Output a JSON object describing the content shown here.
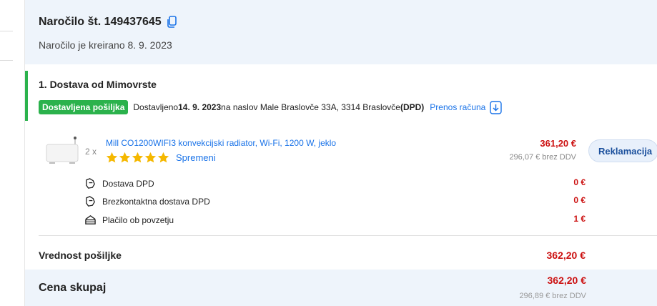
{
  "order": {
    "title": "Naročilo št. 149437645",
    "created": "Naročilo je kreirano 8. 9. 2023"
  },
  "shipment": {
    "title": "1. Dostava od Mimovrste",
    "badge": "Dostavljena pošiljka",
    "delivered_prefix": "Dostavljeno ",
    "delivered_date": "14. 9. 2023",
    "delivered_mid": " na naslov Male Braslovče 33A, 3314 Braslovče ",
    "carrier": "(DPD)",
    "invoice_link": "Prenos računa"
  },
  "product": {
    "qty": "2 x",
    "name": "Mill CO1200WIFI3 konvekcijski radiator, Wi-Fi, 1200 W, jeklo",
    "rating": 5,
    "change_link": "Spremeni",
    "price": "361,20 €",
    "price_ex_vat": "296,07 € brez DDV",
    "complaint_button": "Reklamacija"
  },
  "services": [
    {
      "label": "Dostava DPD",
      "price": "0 €",
      "icon": "delivery-icon"
    },
    {
      "label": "Brezkontaktna dostava DPD",
      "price": "0 €",
      "icon": "delivery-icon"
    },
    {
      "label": "Plačilo ob povzetju",
      "price": "1 €",
      "icon": "cash-payment-icon"
    }
  ],
  "shipment_value": {
    "label": "Vrednost pošiljke",
    "price": "362,20 €"
  },
  "total": {
    "label": "Cena skupaj",
    "price": "362,20 €",
    "price_ex_vat": "296,89 € brez DDV"
  },
  "colors": {
    "accent_blue": "#1a73e8",
    "price_red": "#cc1111",
    "success_green": "#2bb24c",
    "header_bg": "#eef4fb"
  }
}
